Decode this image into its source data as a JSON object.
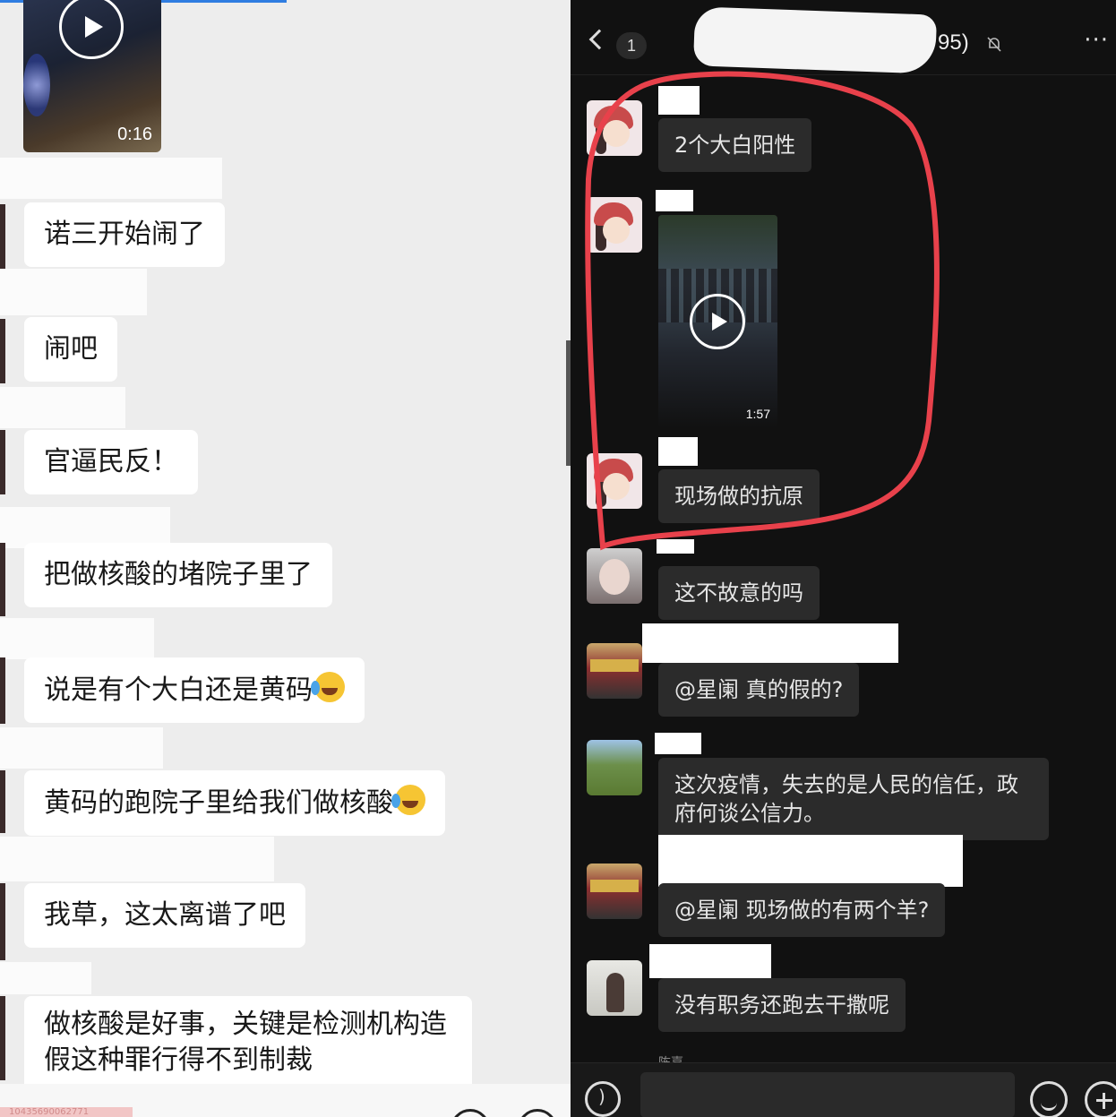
{
  "left_chat": {
    "video": {
      "duration": "0:16"
    },
    "messages": [
      "诺三开始闹了",
      "闹吧",
      "官逼民反！",
      "把做核酸的堵院子里了",
      "说是有个大白还是黄码",
      "黄码的跑院子里给我们做核酸",
      "我草，这太离谱了吧",
      "做核酸是好事，关键是检测机构造假这种罪行得不到制裁"
    ],
    "emoji": "laughing-crying-emoji",
    "bottom_tag": "10435690062771"
  },
  "right_chat": {
    "header": {
      "unread_count": "1",
      "title_tail": "95)",
      "more": "···"
    },
    "video": {
      "duration": "1:57"
    },
    "messages": [
      "2个大白阳性",
      "现场做的抗原",
      "这不故意的吗",
      "@星阑 真的假的?",
      "这次疫情，失去的是人民的信任，政府何谈公信力。",
      "@星阑 现场做的有两个羊?",
      "没有职务还跑去干撒呢"
    ],
    "partial_name": "陈嘉",
    "highlight_color": "#e8414b",
    "icons": [
      "back-icon",
      "mute-icon",
      "more-icon",
      "voice-icon",
      "emoji-icon",
      "plus-icon"
    ]
  }
}
